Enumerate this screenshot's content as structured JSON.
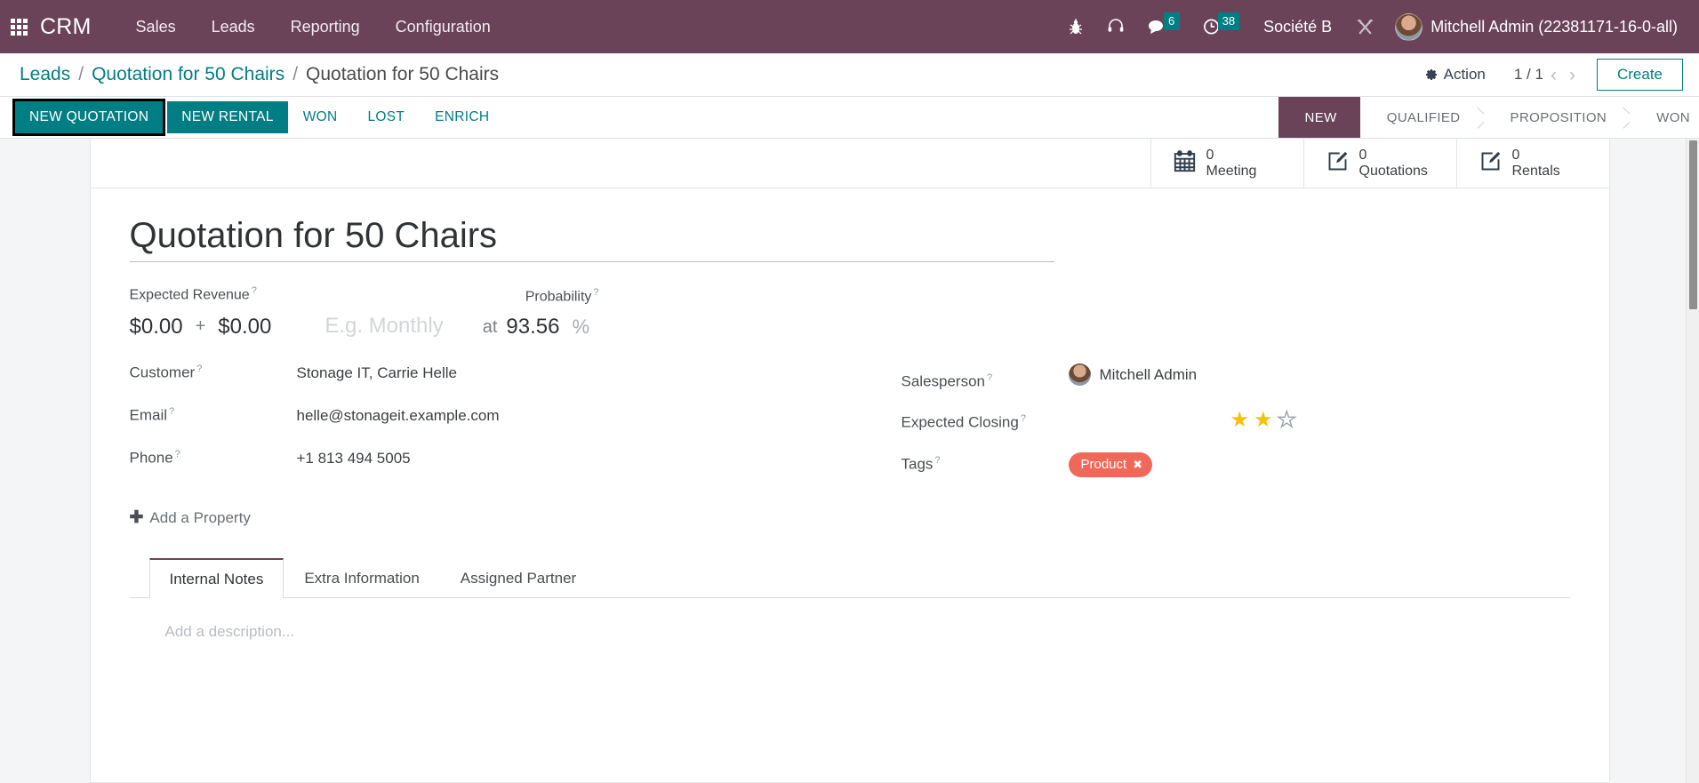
{
  "navbar": {
    "apps_icon": "grid-apps-icon",
    "brand": "CRM",
    "menu": [
      {
        "label": "Sales"
      },
      {
        "label": "Leads"
      },
      {
        "label": "Reporting"
      },
      {
        "label": "Configuration"
      }
    ],
    "icons": [
      {
        "name": "bug-icon"
      },
      {
        "name": "headset-icon"
      }
    ],
    "messages": {
      "icon": "chat-bubble-icon",
      "badge": "6"
    },
    "activities": {
      "icon": "clock-icon",
      "badge": "38"
    },
    "company": "Société B",
    "tools_icon": "tools-icon",
    "user": "Mitchell Admin (22381171-16-0-all)"
  },
  "breadcrumb": {
    "items": [
      "Leads",
      "Quotation for 50 Chairs",
      "Quotation for 50 Chairs"
    ],
    "separator": "/"
  },
  "control_panel": {
    "action_label": "Action",
    "action_icon": "gear-icon",
    "pager": "1 / 1",
    "prev_icon": "chevron-left-icon",
    "next_icon": "chevron-right-icon",
    "create_label": "Create"
  },
  "statusbar": {
    "buttons": [
      {
        "label": "NEW QUOTATION",
        "style": "primary",
        "highlighted": true
      },
      {
        "label": "NEW RENTAL",
        "style": "primary",
        "highlighted": false
      },
      {
        "label": "WON",
        "style": "link",
        "highlighted": false
      },
      {
        "label": "LOST",
        "style": "link",
        "highlighted": false
      },
      {
        "label": "ENRICH",
        "style": "link",
        "highlighted": false
      }
    ],
    "stages": [
      {
        "label": "NEW",
        "active": true
      },
      {
        "label": "QUALIFIED",
        "active": false
      },
      {
        "label": "PROPOSITION",
        "active": false
      },
      {
        "label": "WON",
        "active": false
      }
    ]
  },
  "stat_buttons": [
    {
      "icon": "calendar-icon",
      "value": "0",
      "label": "Meeting"
    },
    {
      "icon": "pencil-square-icon",
      "value": "0",
      "label": "Quotations"
    },
    {
      "icon": "pencil-square-icon",
      "value": "0",
      "label": "Rentals"
    }
  ],
  "record": {
    "title": "Quotation for 50 Chairs",
    "expected_revenue": {
      "label": "Expected Revenue",
      "value": "$0.00",
      "plus": "+",
      "recurring_value": "$0.00",
      "recurring_placeholder": "E.g. Monthly",
      "at": "at"
    },
    "probability": {
      "label": "Probability",
      "value": "93.56",
      "suffix": "%"
    },
    "left_fields": [
      {
        "label": "Customer",
        "value": "Stonage IT, Carrie Helle"
      },
      {
        "label": "Email",
        "value": "helle@stonageit.example.com"
      },
      {
        "label": "Phone",
        "value": "+1 813 494 5005"
      }
    ],
    "salesperson": {
      "label": "Salesperson",
      "value": "Mitchell Admin"
    },
    "expected_closing": {
      "label": "Expected Closing",
      "value": ""
    },
    "priority": {
      "filled": 2,
      "total": 3,
      "star_on": "★",
      "star_off": "☆"
    },
    "tags": {
      "label": "Tags",
      "items": [
        {
          "name": "Product",
          "remove": "✖"
        }
      ]
    },
    "add_property": {
      "label": "Add a Property",
      "plus": "✚"
    }
  },
  "notebook": {
    "tabs": [
      {
        "label": "Internal Notes",
        "active": true
      },
      {
        "label": "Extra Information",
        "active": false
      },
      {
        "label": "Assigned Partner",
        "active": false
      }
    ],
    "description_placeholder": "Add a description..."
  },
  "colors": {
    "navbar": "#6b4358",
    "accent_teal": "#017e84",
    "tag_red": "#f0685a",
    "star_gold": "#f4c20d",
    "highlight_box": "#000000"
  }
}
